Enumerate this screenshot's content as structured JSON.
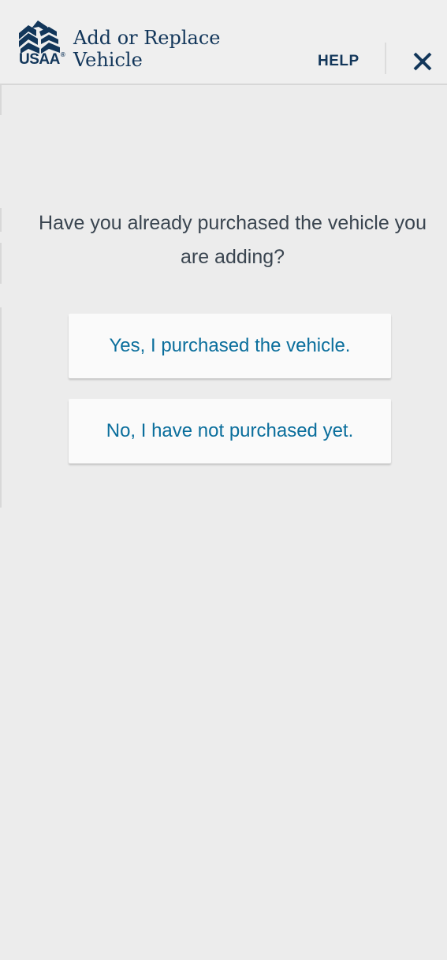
{
  "header": {
    "brand": "USAA",
    "brand_mark": "®",
    "title_line1": "Add or Replace",
    "title_line2": "Vehicle",
    "help_label": "HELP",
    "close_icon": "close-icon",
    "logo_icon": "eagle-logo-icon"
  },
  "main": {
    "question": "Have you already purchased the vehicle you are adding?",
    "options": [
      {
        "label": "Yes, I purchased the vehicle."
      },
      {
        "label": "No, I have not purchased yet."
      }
    ]
  },
  "colors": {
    "brand_navy": "#12365a",
    "link_blue": "#0a6e9c",
    "background": "#ececec",
    "button_bg": "#fafafa",
    "text_gray": "#3a4550"
  }
}
